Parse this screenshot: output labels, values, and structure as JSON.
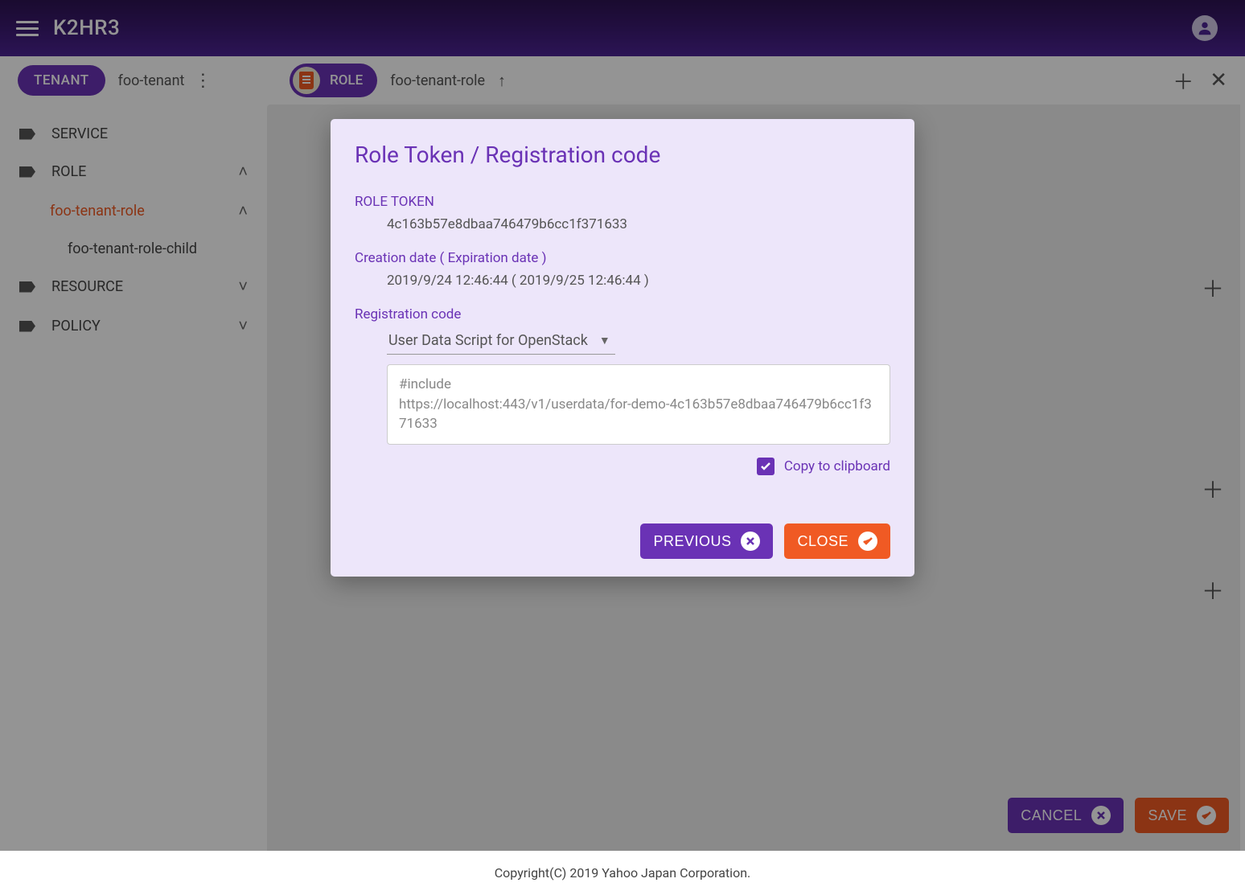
{
  "header": {
    "app_title": "K2HR3"
  },
  "subheader": {
    "tenant_chip": "TENANT",
    "tenant_name": "foo-tenant",
    "role_chip": "ROLE",
    "role_path": "foo-tenant-role"
  },
  "sidebar": {
    "items": [
      {
        "label": "SERVICE"
      },
      {
        "label": "ROLE"
      },
      {
        "label": "foo-tenant-role"
      },
      {
        "label": "foo-tenant-role-child"
      },
      {
        "label": "RESOURCE"
      },
      {
        "label": "POLICY"
      }
    ]
  },
  "main": {
    "cancel": "CANCEL",
    "save": "SAVE"
  },
  "modal": {
    "title": "Role Token / Registration code",
    "token_label": "ROLE TOKEN",
    "token_value": "4c163b57e8dbaa746479b6cc1f371633",
    "dates_label": "Creation date ( Expiration date )",
    "dates_value": "2019/9/24 12:46:44 ( 2019/9/25 12:46:44 )",
    "reg_label": "Registration code",
    "dropdown_value": "User Data Script for OpenStack",
    "code_value": "#include\nhttps://localhost:443/v1/userdata/for-demo-4c163b57e8dbaa746479b6cc1f371633",
    "copy_label": "Copy to clipboard",
    "previous": "PREVIOUS",
    "close": "CLOSE"
  },
  "footer": {
    "text": "Copyright(C) 2019 Yahoo Japan Corporation."
  }
}
